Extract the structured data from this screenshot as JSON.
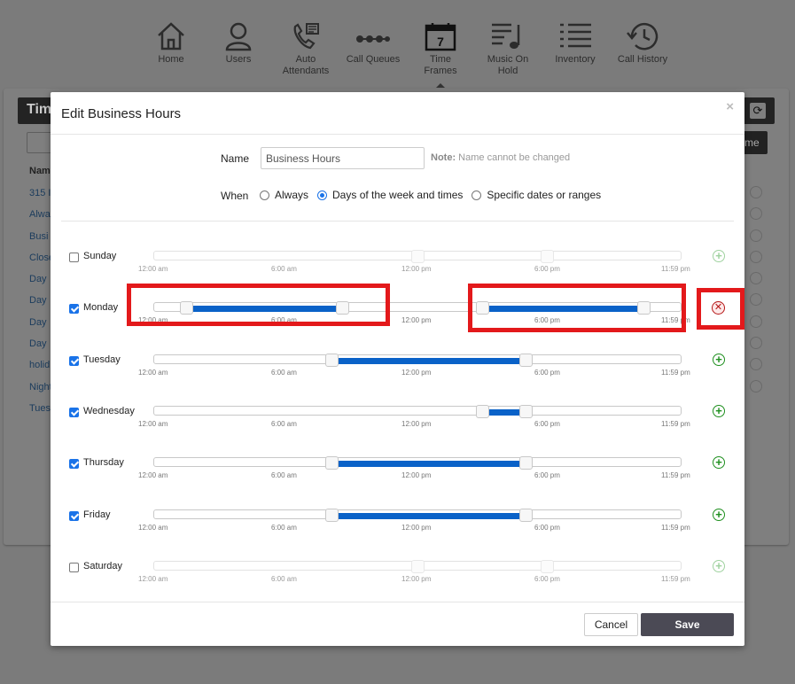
{
  "nav": {
    "items": [
      {
        "label": "Home",
        "icon": "home-icon"
      },
      {
        "label": "Users",
        "icon": "user-icon"
      },
      {
        "label": "Auto\nAttendants",
        "icon": "phone-menu-icon"
      },
      {
        "label": "Call Queues",
        "icon": "queue-icon"
      },
      {
        "label": "Time\nFrames",
        "icon": "calendar-icon",
        "active": true
      },
      {
        "label": "Music On\nHold",
        "icon": "music-icon"
      },
      {
        "label": "Inventory",
        "icon": "list-icon"
      },
      {
        "label": "Call History",
        "icon": "history-icon"
      }
    ]
  },
  "background": {
    "title_fragment": "Tim",
    "name_button_fragment": "me",
    "column_header": "Nam",
    "rows": [
      "315 I",
      "Alwa",
      "Busi",
      "Close",
      "Day",
      "Day",
      "Day",
      "Day",
      "holid",
      "Night",
      "Tues"
    ]
  },
  "modal": {
    "title": "Edit Business Hours",
    "close": "×",
    "name_label": "Name",
    "name_value": "Business Hours",
    "note_bold": "Note:",
    "note_text": "Name cannot be changed",
    "when_label": "When",
    "when_options": [
      {
        "label": "Always",
        "checked": false
      },
      {
        "label": "Days of the week and times",
        "checked": true
      },
      {
        "label": "Specific dates or ranges",
        "checked": false
      }
    ],
    "tick_labels": [
      "12:00 am",
      "6:00 am",
      "12:00 pm",
      "6:00 pm",
      "11:59 pm"
    ],
    "cancel_label": "Cancel",
    "save_label": "Save"
  },
  "days": [
    {
      "name": "Sunday",
      "checked": false,
      "ranges": [],
      "action": "add"
    },
    {
      "name": "Monday",
      "checked": true,
      "ranges": [
        [
          "1:15 am",
          "8:30 am"
        ],
        [
          "3:00 pm",
          "10:30 pm"
        ]
      ],
      "action": "remove"
    },
    {
      "name": "Tuesday",
      "checked": true,
      "ranges": [
        [
          "8:00 am",
          "5:00 pm"
        ]
      ],
      "action": "add"
    },
    {
      "name": "Wednesday",
      "checked": true,
      "ranges": [
        [
          "3:00 pm",
          "5:00 pm"
        ]
      ],
      "action": "add"
    },
    {
      "name": "Thursday",
      "checked": true,
      "ranges": [
        [
          "8:00 am",
          "5:00 pm"
        ]
      ],
      "action": "add"
    },
    {
      "name": "Friday",
      "checked": true,
      "ranges": [
        [
          "8:00 am",
          "5:00 pm"
        ]
      ],
      "action": "add"
    },
    {
      "name": "Saturday",
      "checked": false,
      "ranges": [],
      "action": "add"
    }
  ],
  "colors": {
    "range": "#0a62c8",
    "highlight": "#e3191b",
    "save_button": "#4b4a55"
  }
}
